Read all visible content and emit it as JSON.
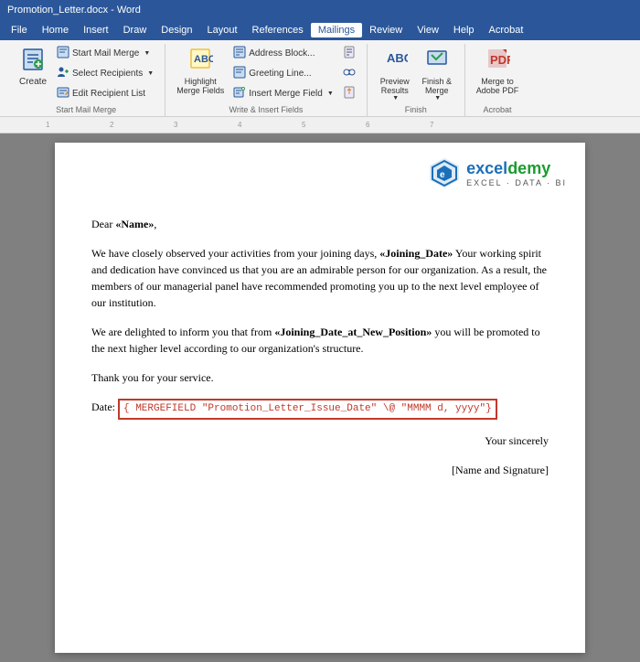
{
  "titleBar": {
    "title": "Promotion_Letter.docx - Word"
  },
  "menuBar": {
    "items": [
      "File",
      "Home",
      "Insert",
      "Draw",
      "Design",
      "Layout",
      "References",
      "Mailings",
      "Review",
      "View",
      "Help",
      "Acrobat"
    ]
  },
  "ribbon": {
    "activeTab": "Mailings",
    "groups": [
      {
        "name": "Start Mail Merge",
        "buttons": [
          {
            "label": "Create",
            "icon": "✉"
          },
          {
            "label": "Start Mail Merge",
            "icon": "📧",
            "dropdown": true
          },
          {
            "label": "Select Recipients",
            "icon": "👥",
            "dropdown": true
          },
          {
            "label": "Edit Recipient List",
            "icon": "✏️"
          }
        ]
      },
      {
        "name": "Write & Insert Fields",
        "buttons": [
          {
            "label": "Highlight Merge Fields",
            "icon": "🖌"
          },
          {
            "label": "Address Block",
            "icon": "📮"
          },
          {
            "label": "Greeting Line",
            "icon": "👋"
          },
          {
            "label": "Insert Merge Field",
            "icon": "📄",
            "dropdown": true
          }
        ]
      },
      {
        "name": "Finish",
        "buttons": [
          {
            "label": "Preview Results",
            "icon": "👁",
            "dropdown": true
          },
          {
            "label": "Finish & Merge",
            "icon": "🔗",
            "dropdown": true
          }
        ]
      },
      {
        "name": "Acrobat",
        "buttons": [
          {
            "label": "Merge to Adobe PDF",
            "icon": "📑"
          }
        ]
      }
    ]
  },
  "document": {
    "logoText": "exceldemy",
    "logoSubText": "EXCEL · DATA · BI",
    "greeting": "Dear ",
    "greetingField": "«Name»",
    "greetingEnd": ",",
    "para1Start": "We have closely observed your activities from your joining days, ",
    "para1Field": "«Joining_Date»",
    "para1Mid": " Your working spirit and dedication have convinced us that you are an admirable person for our organization. As a result, the members of our managerial panel have recommended promoting you up to the next level employee of our institution.",
    "para2Start": "We are delighted to inform you that from ",
    "para2Field": "«Joining_Date_at_New_Position»",
    "para2End": " you will be promoted to the next higher level according to our organization's structure.",
    "para3": "Thank you for your service.",
    "dateLabel": "Date: ",
    "dateField": "{ MERGEFIELD \"Promotion_Letter_Issue_Date\" \\@ \"MMMM d, yyyy\"}",
    "closing": "Your sincerely",
    "signature": "[Name and Signature]"
  }
}
